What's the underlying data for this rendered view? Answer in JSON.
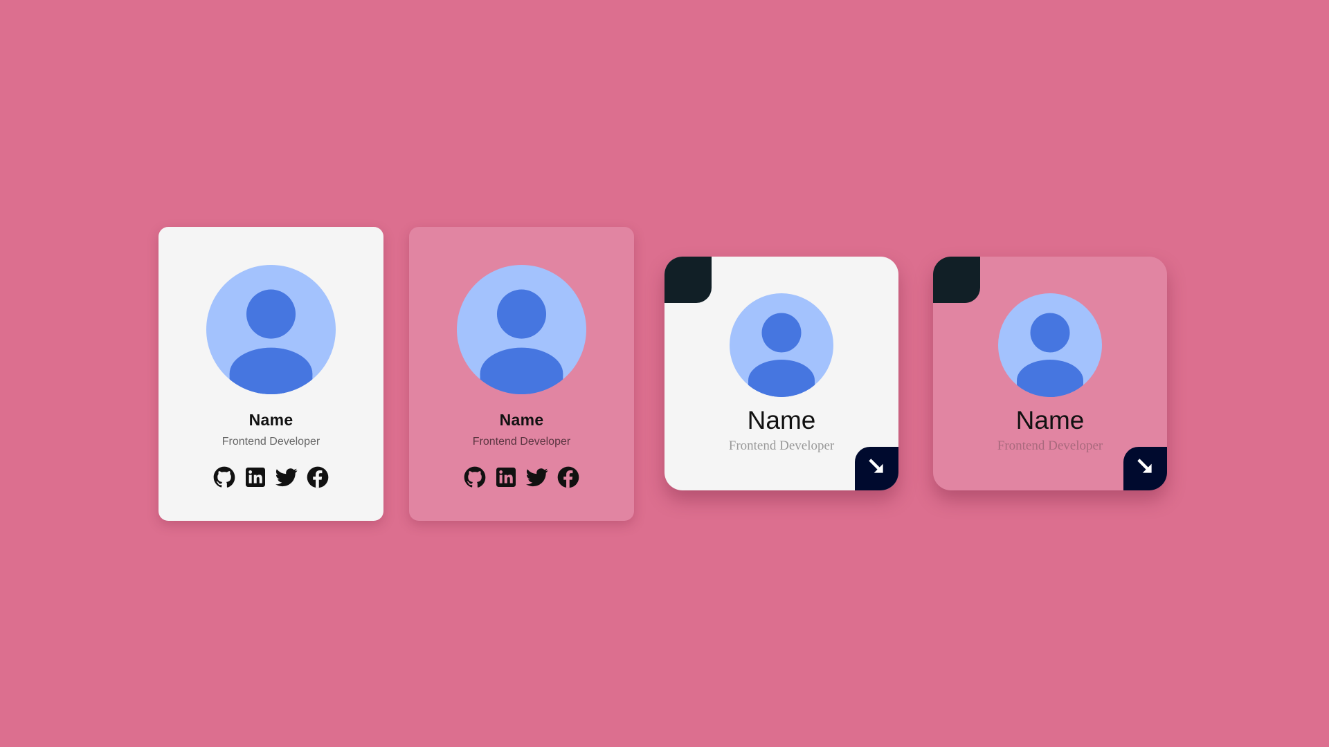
{
  "colors": {
    "background": "#dc6f8f",
    "card_light": "#f5f5f5",
    "card_pink": "#e185a2",
    "avatar_bg": "#a3c2fd",
    "avatar_figure": "#4676e0",
    "corner_dark": "#111f26",
    "corner_navy": "#000a2e"
  },
  "cards": [
    {
      "style": "vertical-light",
      "name": "Name",
      "role": "Frontend Developer",
      "avatar_icon": "user-avatar-icon",
      "socials": [
        "github-icon",
        "linkedin-icon",
        "twitter-icon",
        "facebook-icon"
      ]
    },
    {
      "style": "vertical-pink",
      "name": "Name",
      "role": "Frontend Developer",
      "avatar_icon": "user-avatar-icon",
      "socials": [
        "github-icon",
        "linkedin-icon",
        "twitter-icon",
        "facebook-icon"
      ]
    },
    {
      "style": "square-light",
      "name": "Name",
      "role": "Frontend Developer",
      "avatar_icon": "user-avatar-icon",
      "corner_icon": "arrow-down-right-icon"
    },
    {
      "style": "square-pink",
      "name": "Name",
      "role": "Frontend Developer",
      "avatar_icon": "user-avatar-icon",
      "corner_icon": "arrow-down-right-icon"
    }
  ]
}
